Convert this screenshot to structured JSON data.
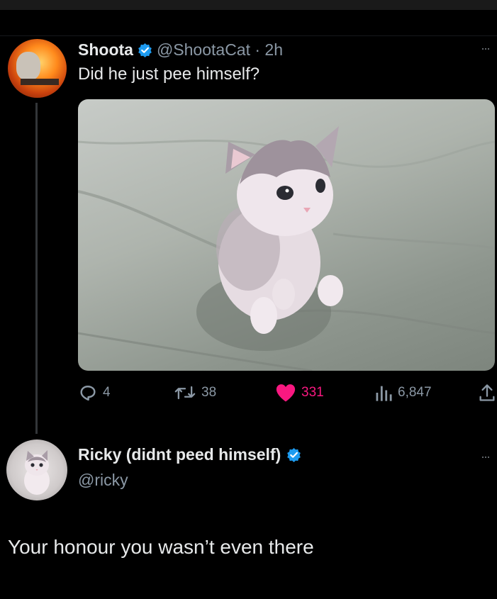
{
  "tweet": {
    "author_name": "Shoota",
    "handle_time": "@ShootaCat · 2h",
    "text": "Did he just pee himself?",
    "media_icon": "kitten-photo",
    "stats": {
      "replies": "4",
      "retweets": "38",
      "likes": "331",
      "views": "6,847"
    }
  },
  "reply": {
    "author_name": "Ricky (didnt peed himself)",
    "handle": "@ricky",
    "text": "Your honour you wasn’t even there"
  },
  "colors": {
    "background": "#000000",
    "text": "#e7e9ea",
    "secondary": "#8b98a5",
    "like": "#f91880",
    "verified": "#1d9bf0"
  }
}
